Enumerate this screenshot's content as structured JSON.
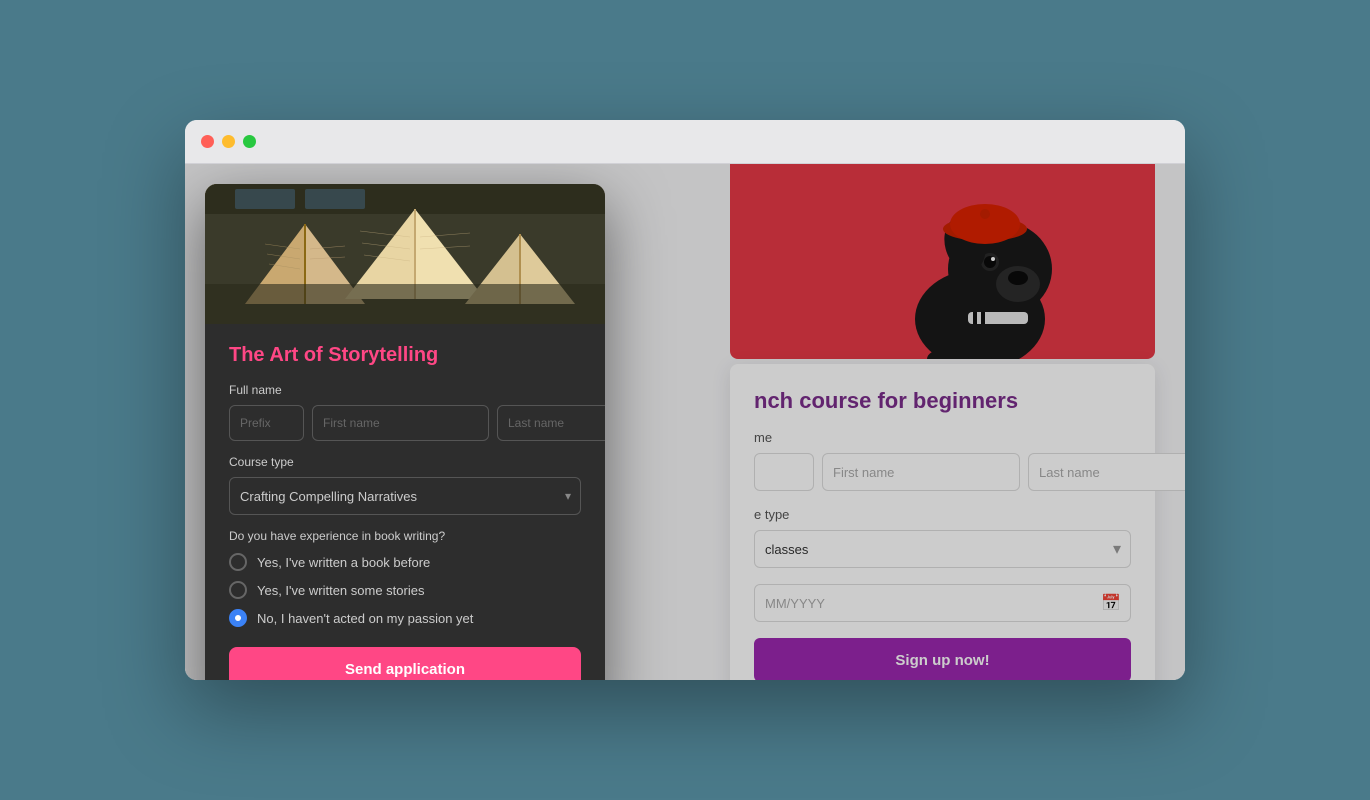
{
  "browser": {
    "traffic_lights": [
      "red",
      "yellow",
      "green"
    ]
  },
  "background_page": {
    "course_title": "nch course for beginners",
    "full_name_label": "me",
    "prefix_placeholder": "",
    "first_name_placeholder": "First name",
    "last_name_placeholder": "Last name",
    "course_type_label": "e type",
    "course_type_value": "classes",
    "date_placeholder": "MM/YYYY",
    "signup_button": "Sign up now!"
  },
  "modal": {
    "title": "The Art of Storytelling",
    "full_name_label": "Full name",
    "prefix_placeholder": "Prefix",
    "first_name_placeholder": "First name",
    "last_name_placeholder": "Last name",
    "course_type_label": "Course type",
    "course_type_value": "Crafting Compelling Narratives",
    "experience_label": "Do you have experience in book writing?",
    "radio_options": [
      {
        "id": "opt1",
        "label": "Yes, I've written a book before",
        "selected": false
      },
      {
        "id": "opt2",
        "label": "Yes, I've written some stories",
        "selected": false
      },
      {
        "id": "opt3",
        "label": "No, I haven't acted on my passion yet",
        "selected": true
      }
    ],
    "send_button": "Send application"
  }
}
